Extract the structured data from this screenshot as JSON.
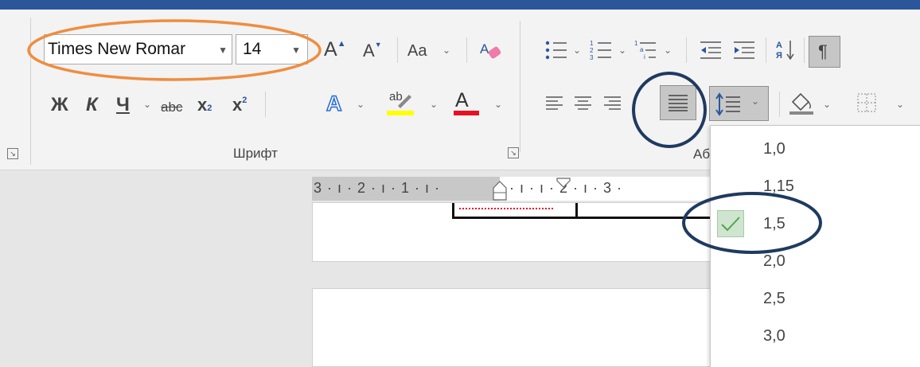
{
  "font": {
    "name": "Times New Romar",
    "size": "14",
    "group_label": "Шрифт",
    "bold": "Ж",
    "italic": "К",
    "underline": "Ч",
    "strike": "abc",
    "subscript_base": "x",
    "subscript_index": "2",
    "superscript_base": "x",
    "superscript_index": "2",
    "change_case": "Aa",
    "grow_font": "A",
    "shrink_font": "A",
    "text_effects": "A",
    "highlight": "ab",
    "font_color": "A"
  },
  "paragraph": {
    "group_label_partial": "Аб",
    "pilcrow": "¶"
  },
  "ruler": {
    "left_text": "3 · ı · 2 · ı · 1 · ı ·",
    "right_text": "· ı · ı · 2 · ı · 3 ·"
  },
  "line_spacing_menu": {
    "items": [
      "1,0",
      "1,15",
      "1,5",
      "2,0",
      "2,5",
      "3,0"
    ],
    "selected": "1,5"
  },
  "colors": {
    "title_bar": "#2b579a",
    "highlight_annotation": "#ef8d3f",
    "circle_annotation": "#1f3a5f",
    "font_color_bar": "#e81123",
    "highlight_bar": "#ffff00",
    "check_mark": "#4ca64c"
  }
}
